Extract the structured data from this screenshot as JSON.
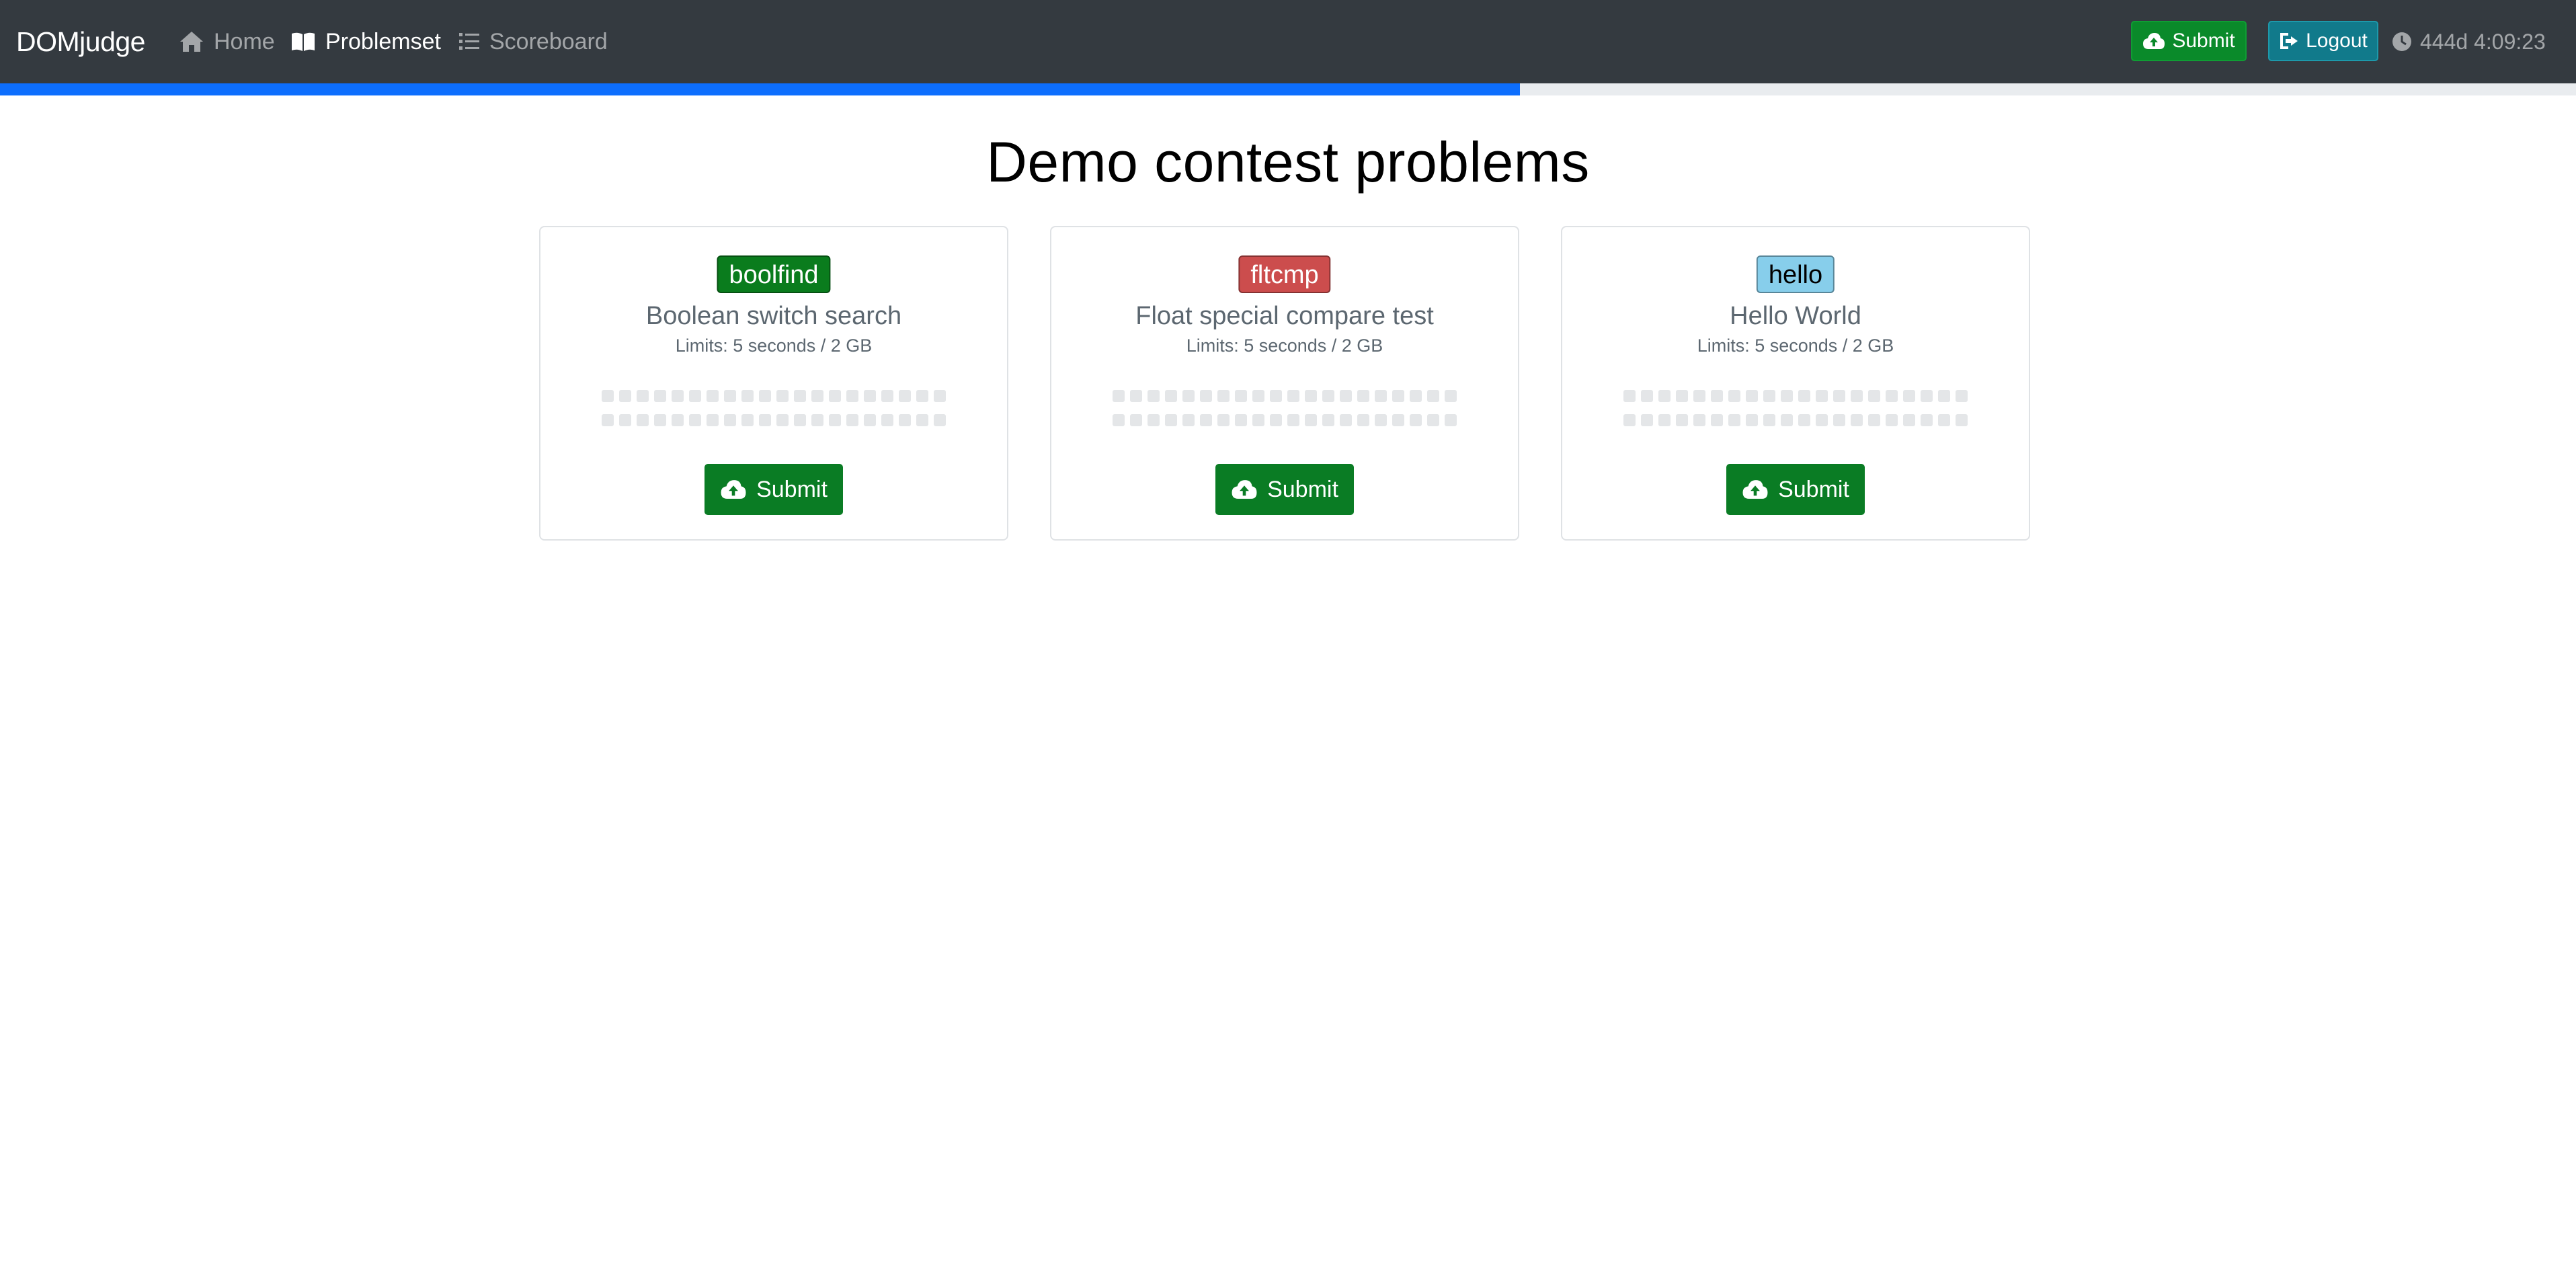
{
  "navbar": {
    "brand": "DOMjudge",
    "links": [
      {
        "label": "Home",
        "icon": "home-icon",
        "active": false
      },
      {
        "label": "Problemset",
        "icon": "book-icon",
        "active": true
      },
      {
        "label": "Scoreboard",
        "icon": "list-ol-icon",
        "active": false
      }
    ],
    "submit_label": "Submit",
    "logout_label": "Logout",
    "clock": "444d 4:09:23"
  },
  "progress": {
    "fraction": 0.59,
    "color": "#0d6efd"
  },
  "page": {
    "title": "Demo contest problems"
  },
  "problems": [
    {
      "shortname": "boolfind",
      "name": "Boolean switch search",
      "limits": "Limits: 5 seconds / 2 GB",
      "badge_bg": "#0a7c1d",
      "badge_fg": "#ffffff",
      "submit_label": "Submit"
    },
    {
      "shortname": "fltcmp",
      "name": "Float special compare test",
      "limits": "Limits: 5 seconds / 2 GB",
      "badge_bg": "#cc4d4d",
      "badge_fg": "#ffffff",
      "submit_label": "Submit"
    },
    {
      "shortname": "hello",
      "name": "Hello World",
      "limits": "Limits: 5 seconds / 2 GB",
      "badge_bg": "#87ceeb",
      "badge_fg": "#000000",
      "submit_label": "Submit"
    }
  ]
}
